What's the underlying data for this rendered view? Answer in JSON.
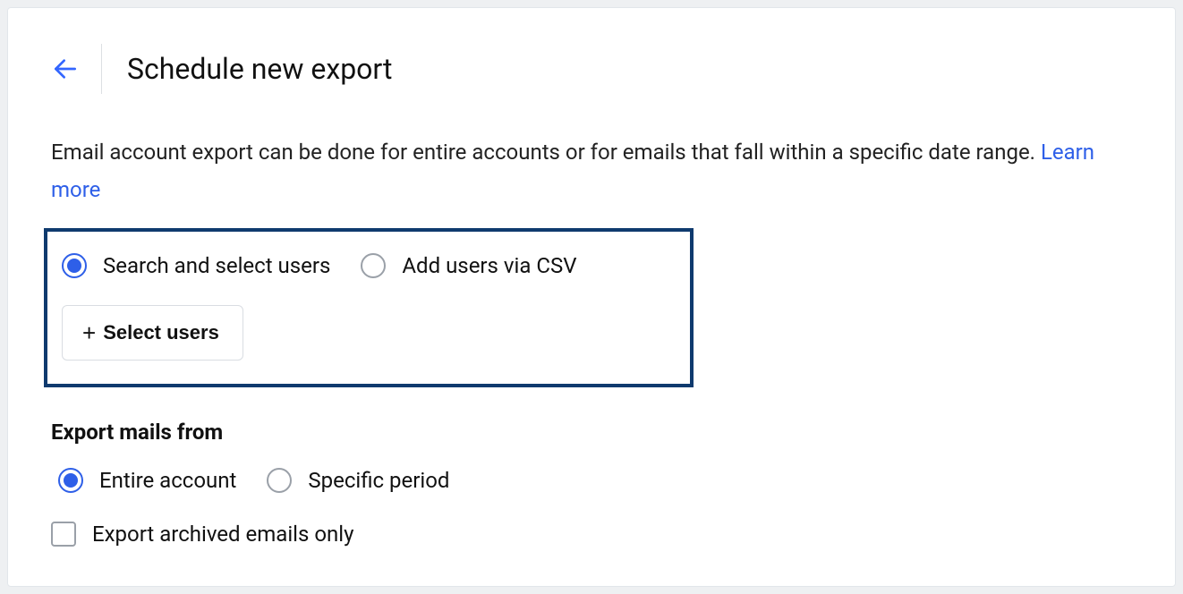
{
  "header": {
    "title": "Schedule new export"
  },
  "description": {
    "text": "Email account export can be done for entire accounts or for emails that fall within a specific date range. ",
    "learn_more": "Learn more"
  },
  "user_selection": {
    "options": [
      {
        "label": "Search and select users",
        "selected": true
      },
      {
        "label": "Add users via CSV",
        "selected": false
      }
    ],
    "select_button": "Select users"
  },
  "export_section": {
    "heading": "Export mails from",
    "options": [
      {
        "label": "Entire account",
        "selected": true
      },
      {
        "label": "Specific period",
        "selected": false
      }
    ],
    "checkbox": {
      "label": "Export archived emails only",
      "checked": false
    }
  }
}
